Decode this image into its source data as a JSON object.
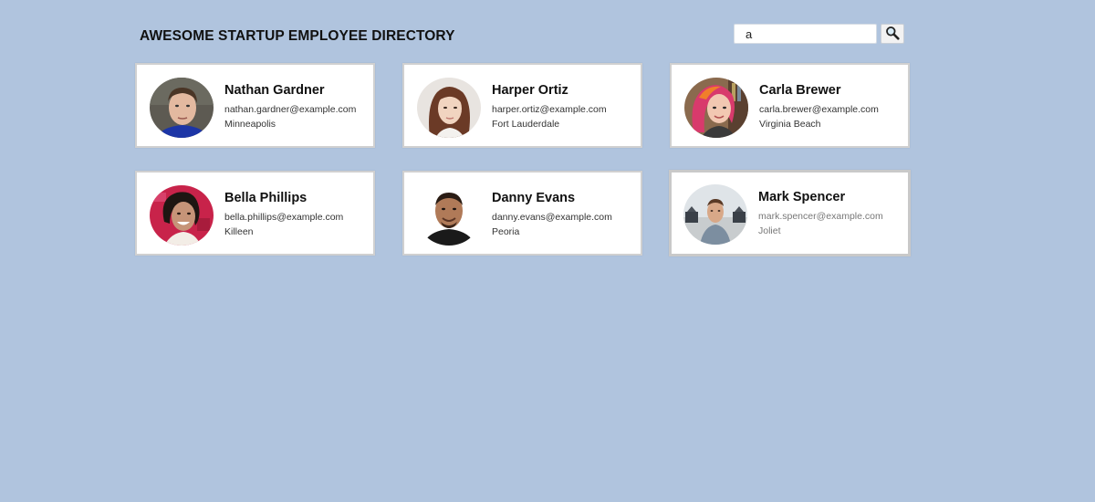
{
  "header": {
    "title": "AWESOME STARTUP EMPLOYEE DIRECTORY"
  },
  "search": {
    "value": "a",
    "placeholder": "",
    "button_icon": "magnifier-icon"
  },
  "employees": [
    {
      "name": "Nathan Gardner",
      "email": "nathan.gardner@example.com",
      "city": "Minneapolis",
      "avatar": "person-photo"
    },
    {
      "name": "Harper Ortiz",
      "email": "harper.ortiz@example.com",
      "city": "Fort Lauderdale",
      "avatar": "person-photo"
    },
    {
      "name": "Carla Brewer",
      "email": "carla.brewer@example.com",
      "city": "Virginia Beach",
      "avatar": "person-photo"
    },
    {
      "name": "Bella Phillips",
      "email": "bella.phillips@example.com",
      "city": "Killeen",
      "avatar": "person-photo"
    },
    {
      "name": "Danny Evans",
      "email": "danny.evans@example.com",
      "city": "Peoria",
      "avatar": "person-photo"
    },
    {
      "name": "Mark Spencer",
      "email": "mark.spencer@example.com",
      "city": "Joliet",
      "avatar": "person-photo"
    }
  ]
}
